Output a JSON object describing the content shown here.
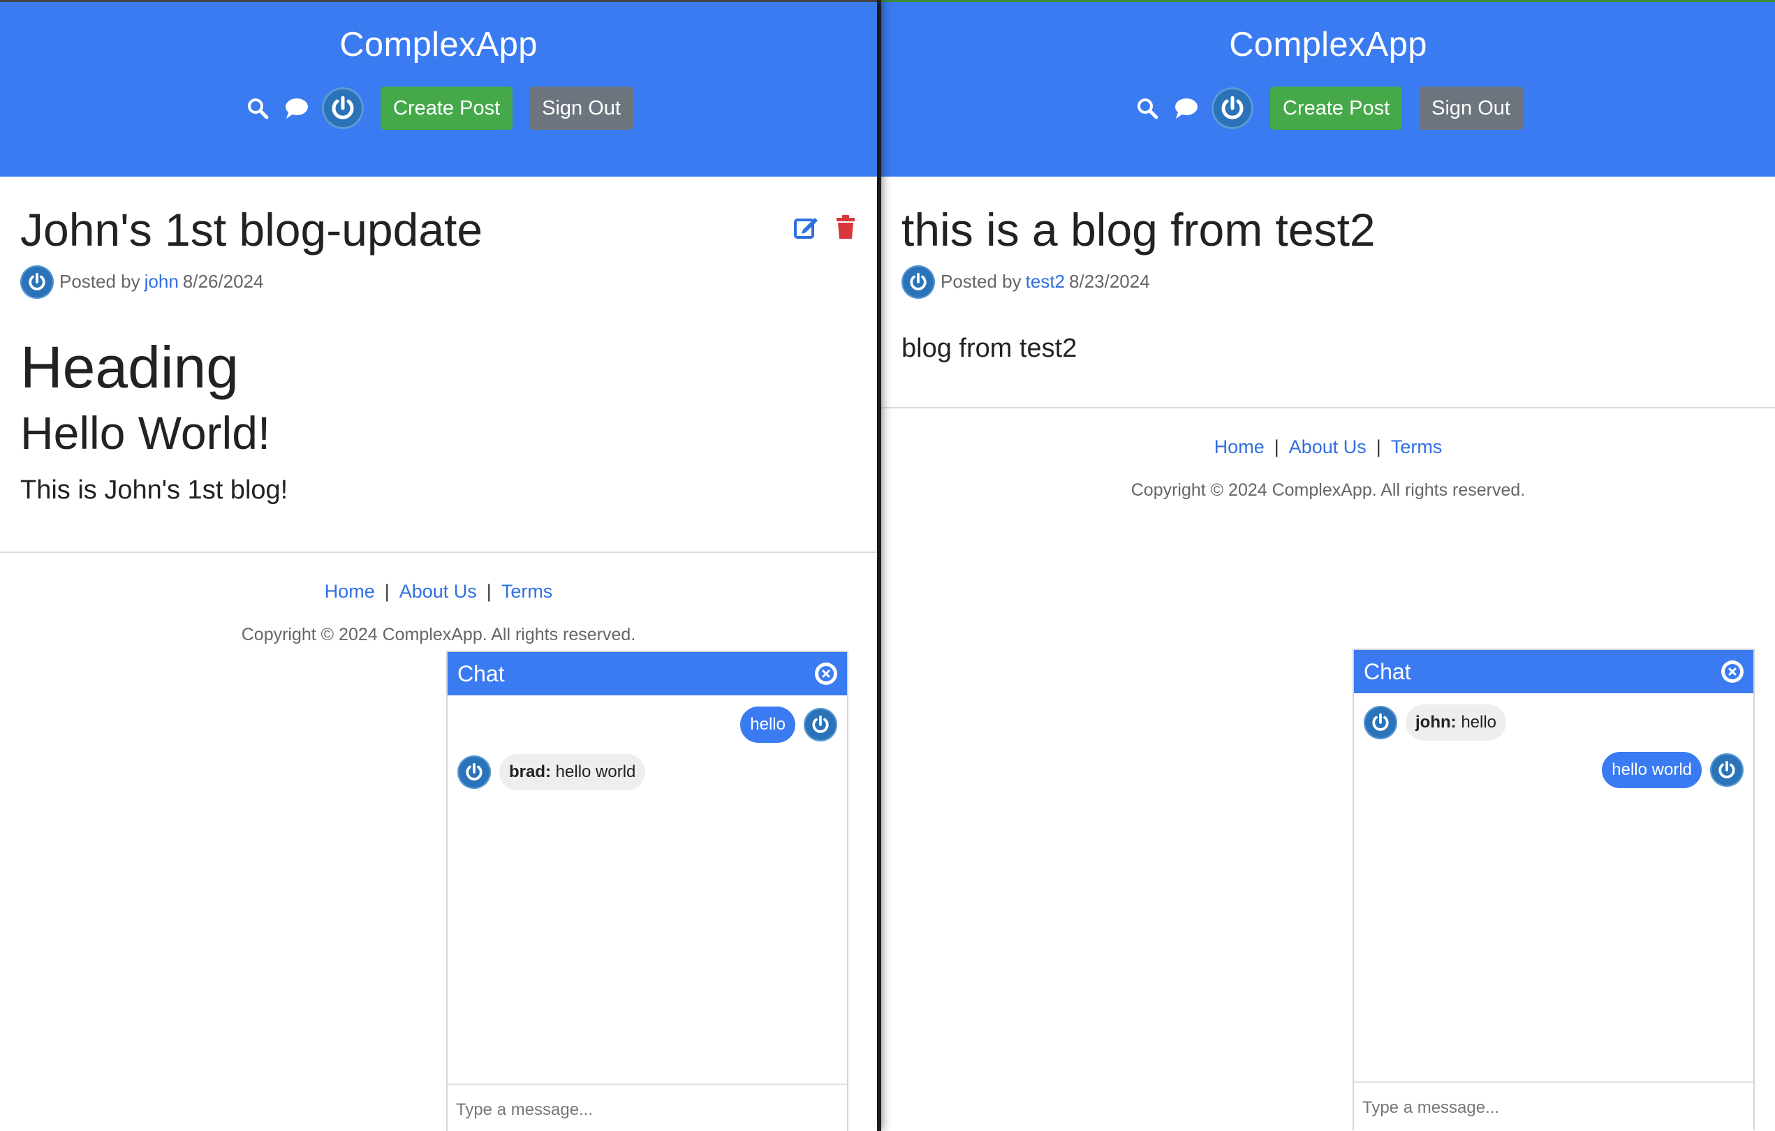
{
  "left": {
    "brand": "ComplexApp",
    "nav": {
      "create_post": "Create Post",
      "sign_out": "Sign Out"
    },
    "post": {
      "title": "John's 1st blog-update",
      "posted_by_prefix": "Posted by",
      "author": "john",
      "date": "8/26/2024",
      "heading": "Heading",
      "subheading": "Hello World!",
      "paragraph": "This is John's 1st blog!"
    },
    "footer": {
      "links": [
        "Home",
        "About Us",
        "Terms"
      ],
      "copyright": "Copyright © 2024 ComplexApp. All rights reserved."
    },
    "chat": {
      "title": "Chat",
      "messages": [
        {
          "self": true,
          "text": "hello"
        },
        {
          "self": false,
          "user": "brad:",
          "text": "hello world"
        }
      ],
      "placeholder": "Type a message..."
    }
  },
  "right": {
    "brand": "ComplexApp",
    "nav": {
      "create_post": "Create Post",
      "sign_out": "Sign Out"
    },
    "post": {
      "title": "this is a blog from test2",
      "posted_by_prefix": "Posted by",
      "author": "test2",
      "date": "8/23/2024",
      "paragraph": "blog from test2"
    },
    "footer": {
      "links": [
        "Home",
        "About Us",
        "Terms"
      ],
      "copyright": "Copyright © 2024 ComplexApp. All rights reserved."
    },
    "chat": {
      "title": "Chat",
      "messages": [
        {
          "self": false,
          "user": "john:",
          "text": "hello"
        },
        {
          "self": true,
          "text": "hello world"
        }
      ],
      "placeholder": "Type a message..."
    }
  },
  "icons": {
    "search": "search-icon",
    "chat": "chat-bubble-icon",
    "avatar": "power-avatar-icon",
    "edit": "edit-icon",
    "delete": "trash-icon",
    "close": "close-circle-icon"
  },
  "colors": {
    "header_blue": "#3a7bf2",
    "create_green": "#45a94a",
    "signout_grey": "#6c757d",
    "link_blue": "#2f6fe0",
    "delete_red": "#d9363e"
  }
}
